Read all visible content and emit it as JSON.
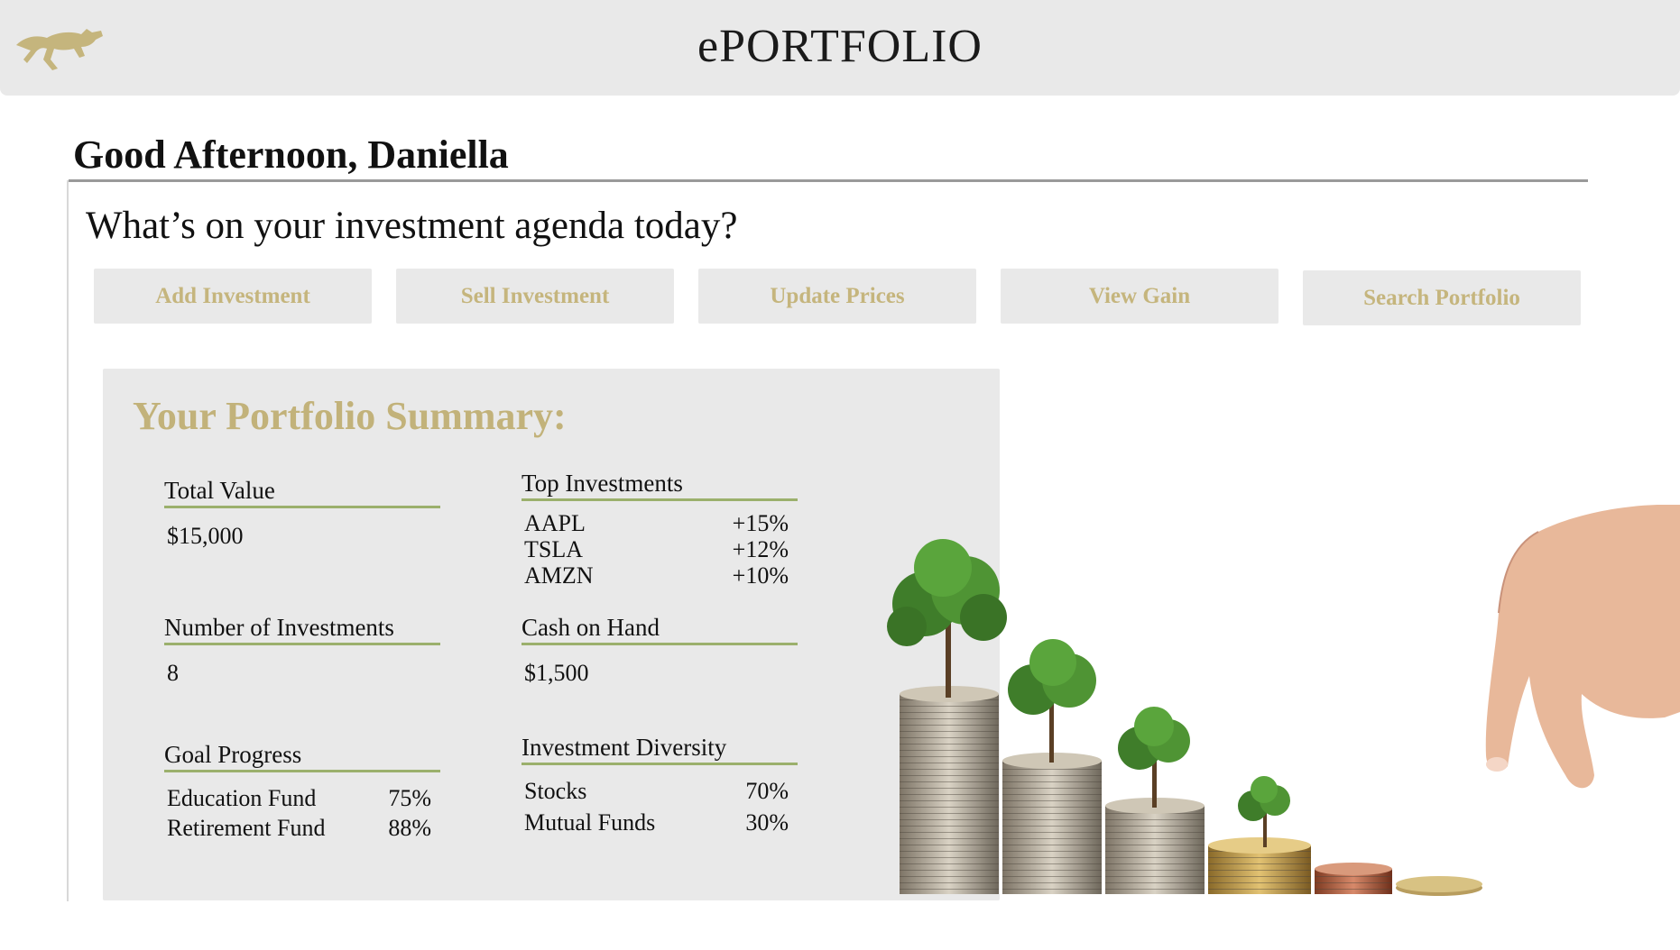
{
  "header": {
    "app_title": "ePORTFOLIO",
    "logo_icon": "cheetah-icon"
  },
  "greeting": "Good Afternoon, Daniella",
  "question": "What’s on your investment agenda today?",
  "actions": [
    {
      "label": "Add Investment"
    },
    {
      "label": "Sell Investment"
    },
    {
      "label": "Update Prices"
    },
    {
      "label": "View Gain"
    },
    {
      "label": "Search Portfolio"
    }
  ],
  "summary": {
    "title": "Your Portfolio Summary:",
    "total_value": {
      "label": "Total Value",
      "value": "$15,000"
    },
    "number_of_investments": {
      "label": "Number of Investments",
      "value": "8"
    },
    "goal_progress": {
      "label": "Goal Progress",
      "items": [
        {
          "name": "Education Fund",
          "value": "75%"
        },
        {
          "name": "Retirement Fund",
          "value": "88%"
        }
      ]
    },
    "top_investments": {
      "label": "Top Investments",
      "items": [
        {
          "name": "AAPL",
          "value": "+15%"
        },
        {
          "name": "TSLA",
          "value": "+12%"
        },
        {
          "name": "AMZN",
          "value": "+10%"
        }
      ]
    },
    "cash_on_hand": {
      "label": "Cash on Hand",
      "value": "$1,500"
    },
    "investment_diversity": {
      "label": "Investment Diversity",
      "items": [
        {
          "name": "Stocks",
          "value": "70%"
        },
        {
          "name": "Mutual Funds",
          "value": "30%"
        }
      ]
    }
  },
  "colors": {
    "accent_gold": "#c5b57d",
    "underline_green": "#9bb06c",
    "panel_bg": "#e9e9e9"
  }
}
